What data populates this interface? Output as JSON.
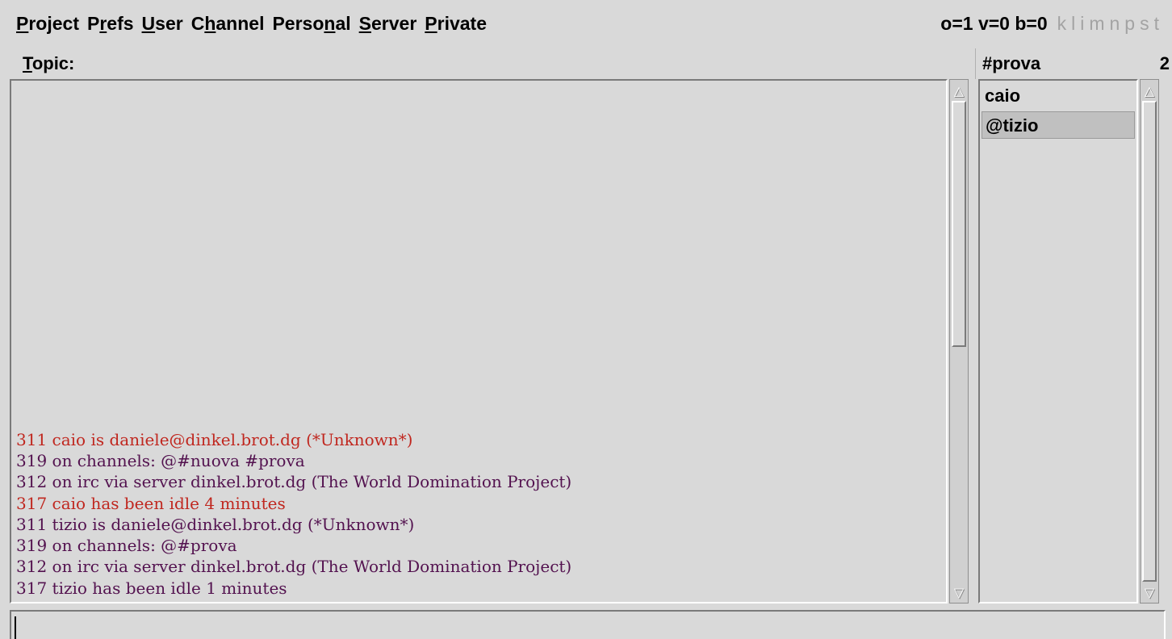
{
  "menubar": {
    "items": [
      {
        "pre": "",
        "ul": "P",
        "post": "roject"
      },
      {
        "pre": "P",
        "ul": "r",
        "post": "efs"
      },
      {
        "pre": "",
        "ul": "U",
        "post": "ser"
      },
      {
        "pre": "C",
        "ul": "h",
        "post": "annel"
      },
      {
        "pre": "Perso",
        "ul": "n",
        "post": "al"
      },
      {
        "pre": "",
        "ul": "S",
        "post": "erver"
      },
      {
        "pre": "",
        "ul": "P",
        "post": "rivate"
      }
    ]
  },
  "modes": {
    "counts": "o=1 v=0 b=0",
    "flags": "klimnpst"
  },
  "topic": {
    "label_ul": "T",
    "label_rest": "opic:"
  },
  "channel": {
    "name": "#prova",
    "user_count": "2"
  },
  "messages": [
    {
      "text": "311 caio is daniele@dinkel.brot.dg (*Unknown*)",
      "color": "red"
    },
    {
      "text": "319 on channels: @#nuova #prova",
      "color": "purple"
    },
    {
      "text": "312 on irc via server dinkel.brot.dg (The World Domination Project)",
      "color": "purple"
    },
    {
      "text": "317 caio has been idle 4 minutes",
      "color": "red"
    },
    {
      "text": "311 tizio is daniele@dinkel.brot.dg (*Unknown*)",
      "color": "purple"
    },
    {
      "text": "319 on channels: @#prova",
      "color": "purple"
    },
    {
      "text": "312 on irc via server dinkel.brot.dg (The World Domination Project)",
      "color": "purple"
    },
    {
      "text": "317 tizio has been idle 1 minutes",
      "color": "purple"
    }
  ],
  "nicks": [
    "caio",
    "@tizio"
  ],
  "input": {
    "value": ""
  },
  "colors": {
    "red": "#c0271f",
    "purple": "#53124f",
    "background": "#d9d9d9"
  },
  "icons": {
    "scroll_up": "up-arrow-icon",
    "scroll_down": "down-arrow-icon"
  }
}
